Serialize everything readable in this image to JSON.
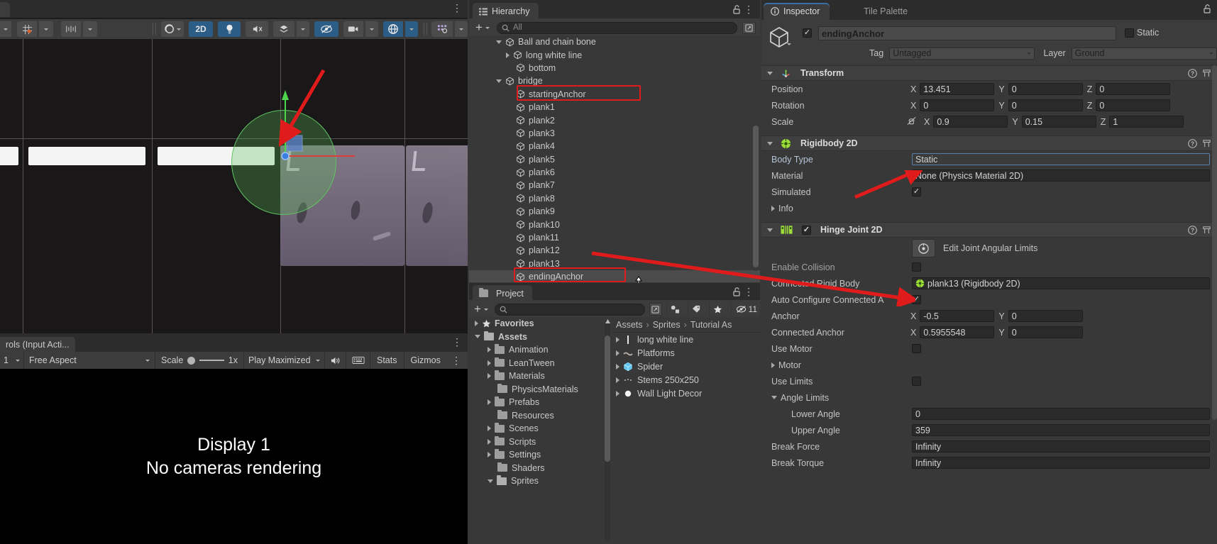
{
  "scene_toolbar": {
    "icons": [
      "pivot-icon",
      "grid-snap-icon",
      "grid-snap-dropdown",
      "snap-increment-icon",
      "snap-increment-dropdown"
    ],
    "right_icons": [
      {
        "name": "shading-mode-icon",
        "label": "",
        "active": false
      },
      {
        "name": "toggle-2d-button",
        "label": "2D",
        "active": true
      },
      {
        "name": "scene-lighting-icon",
        "label": "",
        "active": true
      },
      {
        "name": "scene-audio-icon",
        "label": "",
        "active": false
      },
      {
        "name": "effects-icon",
        "label": "",
        "active": false
      },
      {
        "name": "hidden-objects-icon",
        "label": "",
        "active": true
      },
      {
        "name": "scene-camera-icon",
        "label": "",
        "active": false
      },
      {
        "name": "gizmos-icon",
        "label": "",
        "active": true
      },
      {
        "name": "scene-visibility-icon",
        "label": "",
        "active": false
      }
    ],
    "menu_kebab": "⋮"
  },
  "game_view": {
    "truncated_tab": "rols (Input Acti...",
    "display": "1",
    "aspect": "Free Aspect",
    "scale_label": "Scale",
    "scale_value": "1x",
    "play_mode": "Play Maximized",
    "mute_icon": "speaker-icon",
    "keyboard_icon": "keyboard-icon",
    "stats": "Stats",
    "gizmos": "Gizmos",
    "kebab": "⋮",
    "overlay_line1": "Display 1",
    "overlay_line2": "No cameras rendering"
  },
  "hierarchy": {
    "tab": "Hierarchy",
    "lock_icon": "lock-icon",
    "kebab_icon": "kebab-menu-icon",
    "add_label": "+",
    "search_placeholder": "All",
    "search_value": "",
    "search_icon": "search-icon",
    "filter_icon": "filter-icon",
    "items": [
      {
        "label": "Ball and chain bone",
        "depth": 2,
        "arrow": "open",
        "selected": false,
        "highlight": false
      },
      {
        "label": "long white line",
        "depth": 3,
        "arrow": "closed",
        "selected": false,
        "highlight": false
      },
      {
        "label": "bottom",
        "depth": 3,
        "arrow": "none",
        "selected": false,
        "highlight": false
      },
      {
        "label": "bridge",
        "depth": 2,
        "arrow": "open",
        "selected": false,
        "highlight": false
      },
      {
        "label": "startingAnchor",
        "depth": 3,
        "arrow": "none",
        "selected": false,
        "highlight": true
      },
      {
        "label": "plank1",
        "depth": 3,
        "arrow": "none",
        "selected": false,
        "highlight": false
      },
      {
        "label": "plank2",
        "depth": 3,
        "arrow": "none",
        "selected": false,
        "highlight": false
      },
      {
        "label": "plank3",
        "depth": 3,
        "arrow": "none",
        "selected": false,
        "highlight": false
      },
      {
        "label": "plank4",
        "depth": 3,
        "arrow": "none",
        "selected": false,
        "highlight": false
      },
      {
        "label": "plank5",
        "depth": 3,
        "arrow": "none",
        "selected": false,
        "highlight": false
      },
      {
        "label": "plank6",
        "depth": 3,
        "arrow": "none",
        "selected": false,
        "highlight": false
      },
      {
        "label": "plank7",
        "depth": 3,
        "arrow": "none",
        "selected": false,
        "highlight": false
      },
      {
        "label": "plank8",
        "depth": 3,
        "arrow": "none",
        "selected": false,
        "highlight": false
      },
      {
        "label": "plank9",
        "depth": 3,
        "arrow": "none",
        "selected": false,
        "highlight": false
      },
      {
        "label": "plank10",
        "depth": 3,
        "arrow": "none",
        "selected": false,
        "highlight": false
      },
      {
        "label": "plank11",
        "depth": 3,
        "arrow": "none",
        "selected": false,
        "highlight": false
      },
      {
        "label": "plank12",
        "depth": 3,
        "arrow": "none",
        "selected": false,
        "highlight": false
      },
      {
        "label": "plank13",
        "depth": 3,
        "arrow": "none",
        "selected": false,
        "highlight": false
      },
      {
        "label": "endingAnchor",
        "depth": 3,
        "arrow": "none",
        "selected": true,
        "highlight": true
      }
    ]
  },
  "project": {
    "tab": "Project",
    "lock_icon": "lock-icon",
    "kebab_icon": "kebab-menu-icon",
    "add_label": "+",
    "search_placeholder": "",
    "search_icon": "search-icon",
    "toolbar_icons": [
      "search-in-packages-icon",
      "filter-by-type-icon",
      "filter-by-label-icon",
      "favorites-star-icon",
      "hidden-count-icon"
    ],
    "hidden_count": "11",
    "tree": [
      {
        "label": "Favorites",
        "depth": 0,
        "arrow": "closed",
        "icon": "star"
      },
      {
        "label": "Assets",
        "depth": 0,
        "arrow": "open",
        "icon": "folder-open"
      },
      {
        "label": "Animation",
        "depth": 1,
        "arrow": "closed",
        "icon": "folder"
      },
      {
        "label": "LeanTween",
        "depth": 1,
        "arrow": "closed",
        "icon": "folder"
      },
      {
        "label": "Materials",
        "depth": 1,
        "arrow": "closed",
        "icon": "folder"
      },
      {
        "label": "PhysicsMaterials",
        "depth": 1,
        "arrow": "none",
        "icon": "folder"
      },
      {
        "label": "Prefabs",
        "depth": 1,
        "arrow": "closed",
        "icon": "folder"
      },
      {
        "label": "Resources",
        "depth": 1,
        "arrow": "none",
        "icon": "folder"
      },
      {
        "label": "Scenes",
        "depth": 1,
        "arrow": "closed",
        "icon": "folder"
      },
      {
        "label": "Scripts",
        "depth": 1,
        "arrow": "closed",
        "icon": "folder"
      },
      {
        "label": "Settings",
        "depth": 1,
        "arrow": "closed",
        "icon": "folder"
      },
      {
        "label": "Shaders",
        "depth": 1,
        "arrow": "none",
        "icon": "folder"
      },
      {
        "label": "Sprites",
        "depth": 1,
        "arrow": "open",
        "icon": "folder-open"
      }
    ],
    "breadcrumb": [
      "Assets",
      "Sprites",
      "Tutorial As"
    ],
    "contents": [
      {
        "label": "long white line",
        "arrow": "closed",
        "icon": "sprite-line"
      },
      {
        "label": "Platforms",
        "arrow": "closed",
        "icon": "sprite-platform"
      },
      {
        "label": "Spider",
        "arrow": "closed",
        "icon": "prefab-cube"
      },
      {
        "label": "Stems 250x250",
        "arrow": "closed",
        "icon": "sprite-stems"
      },
      {
        "label": "Wall Light Decor",
        "arrow": "closed",
        "icon": "sprite-light"
      }
    ]
  },
  "inspector": {
    "tabs": [
      {
        "label": "Inspector",
        "active": true,
        "icon": "info-icon"
      },
      {
        "label": "Tile Palette",
        "active": false,
        "icon": ""
      }
    ],
    "lock_icon": "lock-icon",
    "object": {
      "enabled": true,
      "name": "endingAnchor",
      "static_label": "Static",
      "tag_label": "Tag",
      "tag_value": "Untagged",
      "layer_label": "Layer",
      "layer_value": "Ground",
      "icon": "gameobject-cube-icon"
    },
    "components": [
      {
        "name": "Transform",
        "icon": "transform-icon",
        "expanded": true,
        "has_checkbox": false,
        "help_icon": "help-icon",
        "preset_icon": "preset-icon",
        "rows": [
          {
            "type": "vec3",
            "label": "Position",
            "x": "13.451",
            "y": "0",
            "z": "0"
          },
          {
            "type": "vec3",
            "label": "Rotation",
            "x": "0",
            "y": "0",
            "z": "0"
          },
          {
            "type": "vec3",
            "label": "Scale",
            "x": "0.9",
            "y": "0.15",
            "z": "1",
            "lock_icon": "constrain-proportions-off-icon"
          }
        ]
      },
      {
        "name": "Rigidbody 2D",
        "icon": "rigidbody2d-icon",
        "expanded": true,
        "has_checkbox": false,
        "help_icon": "help-icon",
        "preset_icon": "preset-icon",
        "rows": [
          {
            "type": "dropdown",
            "label": "Body Type",
            "value": "Static",
            "highlighted": true
          },
          {
            "type": "object",
            "label": "Material",
            "value": "None (Physics Material 2D)"
          },
          {
            "type": "checkbox",
            "label": "Simulated",
            "value": true
          },
          {
            "type": "foldout",
            "label": "Info",
            "expanded": false
          }
        ]
      },
      {
        "name": "Hinge Joint 2D",
        "icon": "hingejoint2d-icon",
        "expanded": true,
        "has_checkbox": true,
        "checkbox_value": true,
        "help_icon": "help-icon",
        "preset_icon": "preset-icon",
        "rows": [
          {
            "type": "button",
            "label": "Edit Joint Angular Limits",
            "icon": "edit-joint-icon"
          },
          {
            "type": "checkbox",
            "label": "Enable Collision",
            "value": false
          },
          {
            "type": "object-ref",
            "label": "Connected Rigid Body",
            "value": "plank13 (Rigidbody 2D)",
            "icon": "rigidbody2d-icon"
          },
          {
            "type": "checkbox",
            "label": "Auto Configure Connected A",
            "value": true
          },
          {
            "type": "vec2",
            "label": "Anchor",
            "x": "-0.5",
            "y": "0"
          },
          {
            "type": "vec2",
            "label": "Connected Anchor",
            "x": "0.5955548",
            "y": "0"
          },
          {
            "type": "checkbox",
            "label": "Use Motor",
            "value": false
          },
          {
            "type": "foldout",
            "label": "Motor",
            "expanded": false
          },
          {
            "type": "checkbox",
            "label": "Use Limits",
            "value": false
          },
          {
            "type": "foldout",
            "label": "Angle Limits",
            "expanded": true
          },
          {
            "type": "text",
            "label": "Lower Angle",
            "value": "0",
            "indent": true
          },
          {
            "type": "text",
            "label": "Upper Angle",
            "value": "359",
            "indent": true
          },
          {
            "type": "text",
            "label": "Break Force",
            "value": "Infinity"
          },
          {
            "type": "text",
            "label": "Break Torque",
            "value": "Infinity"
          }
        ]
      }
    ]
  },
  "colors": {
    "panel_bg": "#383838",
    "header_bg": "#3c3c3c",
    "dark_bg": "#2c2c2c",
    "field_bg": "#2a2a2a",
    "accent_blue": "#3b6ea5",
    "annotation_red": "#e01b1b",
    "selection_gray": "#4a4a4a",
    "text": "#c4c4c4"
  }
}
